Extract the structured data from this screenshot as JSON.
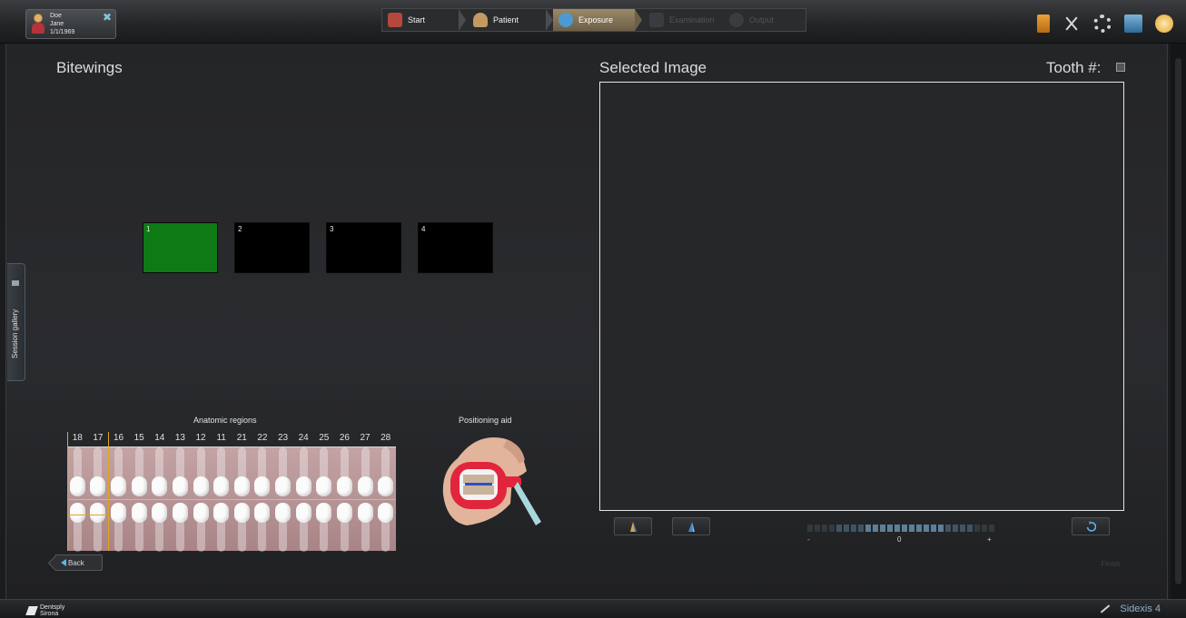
{
  "patient": {
    "last_name": "Doe",
    "first_name": "Jane",
    "dob": "1/1/1969"
  },
  "workflow": {
    "steps": [
      {
        "label": "Start",
        "state": "done"
      },
      {
        "label": "Patient",
        "state": "done"
      },
      {
        "label": "Exposure",
        "state": "active"
      },
      {
        "label": "Examination",
        "state": "disabled"
      },
      {
        "label": "Output",
        "state": "disabled"
      }
    ]
  },
  "toolbar_icons": [
    "exit-door-icon",
    "tools-icon",
    "settings-gear-icon",
    "notes-icon",
    "help-icon"
  ],
  "left_panel": {
    "title": "Bitewings",
    "slots": [
      "1",
      "2",
      "3",
      "4"
    ],
    "selected_slot": "1",
    "selected_color": "#0d7a16"
  },
  "session_gallery": {
    "label": "Session gallery"
  },
  "anatomic": {
    "title": "Anatomic regions",
    "tooth_numbers": [
      "18",
      "17",
      "16",
      "15",
      "14",
      "13",
      "12",
      "11",
      "21",
      "22",
      "23",
      "24",
      "25",
      "26",
      "27",
      "28"
    ],
    "selected_teeth": [
      "18",
      "17"
    ],
    "highlight_color": "#e0a520"
  },
  "positioning": {
    "title": "Positioning aid"
  },
  "back_label": "Back",
  "right_panel": {
    "title": "Selected Image",
    "tooth_label": "Tooth #:"
  },
  "contrast": {
    "min_label": "-",
    "center_label": "0",
    "max_label": "+"
  },
  "finish_label": "Finish",
  "footer": {
    "brand_line1": "Dentsply",
    "brand_line2": "Sirona",
    "product": "Sidexis 4"
  }
}
